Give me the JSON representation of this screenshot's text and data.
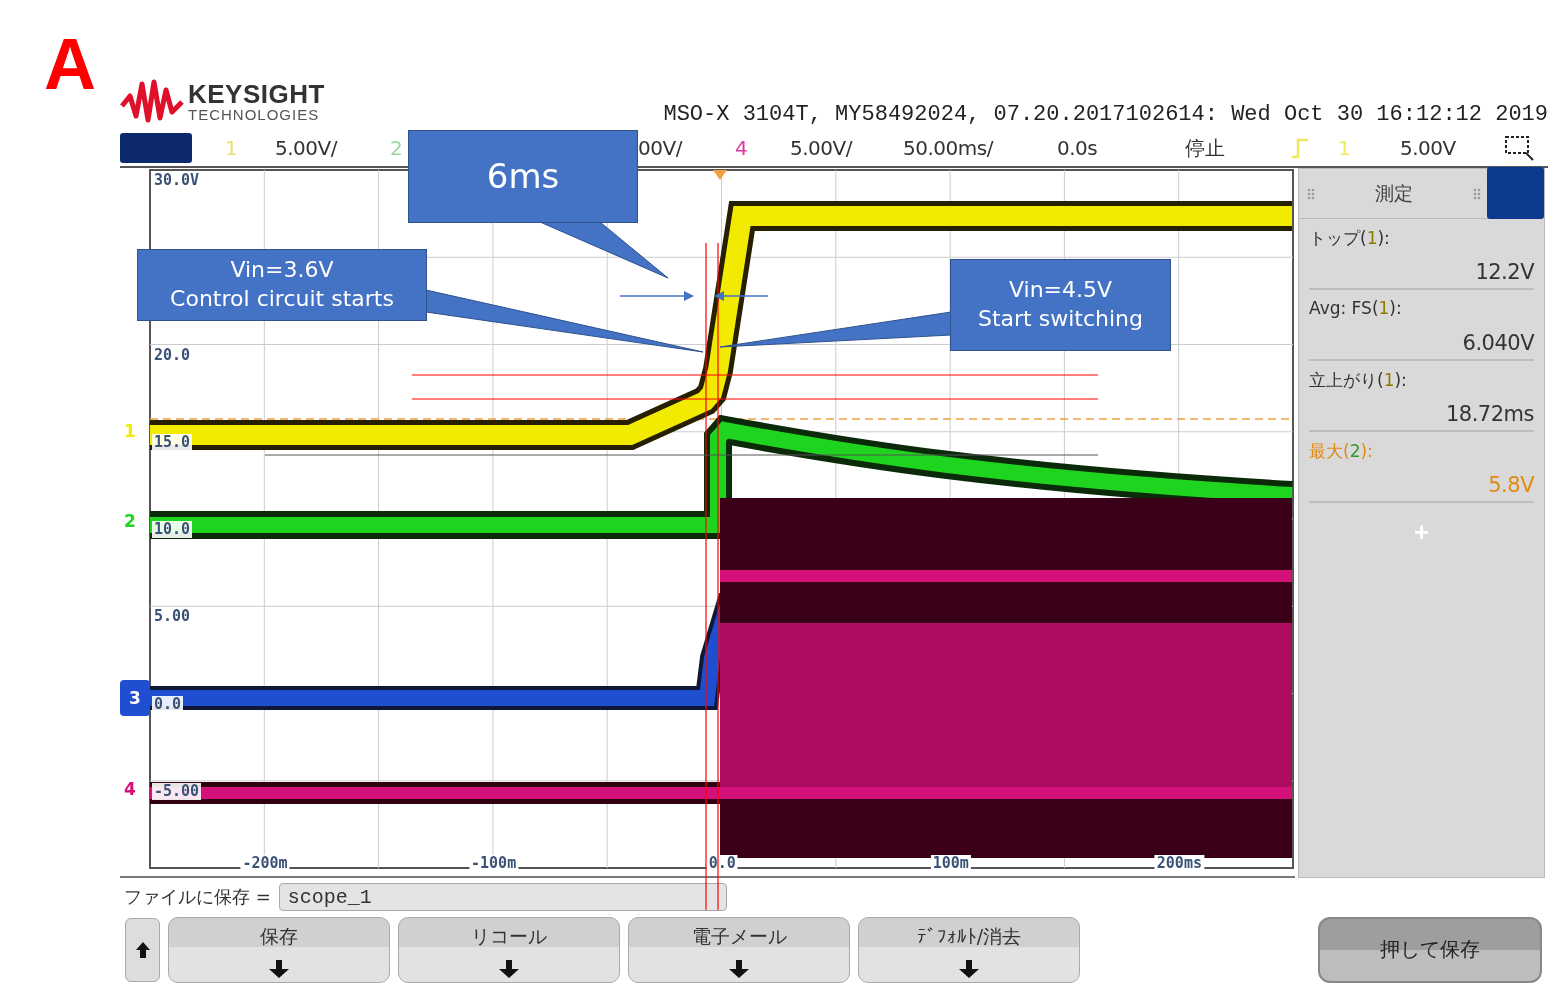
{
  "figure_label": "A",
  "scope": {
    "logo": {
      "name": "KEYSIGHT",
      "subtitle": "TECHNOLOGIES"
    },
    "title": "MSO-X 3104T, MY58492024, 07.20.2017102614: Wed Oct 30 16:12:12 2019",
    "status_bar": {
      "channels": [
        {
          "label": "1",
          "value": "5.00V/",
          "color": "#e6e070"
        },
        {
          "label": "2",
          "color": "#9ad89a"
        },
        {
          "value": "00V/"
        },
        {
          "label": "4",
          "value": "5.00V/",
          "color": "#e03aa0"
        }
      ],
      "timebase": "50.00ms/",
      "delay": "0.0s",
      "run_state": "停止",
      "trigger": {
        "source": "1",
        "level": "5.00V",
        "color": "#f0e860"
      }
    },
    "plot": {
      "y_labels": [
        "30.0V",
        "20.0",
        "15.0",
        "10.0",
        "5.00",
        "0.0",
        "-5.00"
      ],
      "x_labels": [
        "-200m",
        "-100m",
        "0.0",
        "100m",
        "200ms"
      ],
      "traces": [
        {
          "marker": "1",
          "color": "#f2ea00"
        },
        {
          "marker": "2",
          "color": "#1fd41f"
        },
        {
          "marker": "3",
          "color": "#1f4fd0"
        },
        {
          "marker": "4",
          "color": "#d4107a"
        }
      ]
    },
    "measurements": {
      "title": "測定",
      "items": [
        {
          "label": "トップ(",
          "channel": "1",
          "label_end": "):",
          "value": "12.2V",
          "kind": "normal"
        },
        {
          "label": "Avg: FS(",
          "channel": "1",
          "label_end": "):",
          "value": "6.040V",
          "kind": "normal"
        },
        {
          "label": "立上がり(",
          "channel": "1",
          "label_end": "):",
          "value": "18.72ms",
          "kind": "normal"
        },
        {
          "label": "最大(",
          "channel": "2",
          "label_end": "):",
          "value": "5.8V",
          "kind": "highlight"
        }
      ],
      "add": "+"
    },
    "file": {
      "label": "ファイルに保存 =",
      "value": "scope_1"
    },
    "softkeys": [
      {
        "label": "保存"
      },
      {
        "label": "リコール"
      },
      {
        "label": "電子メール"
      },
      {
        "label": "ﾃﾞﾌｫﾙﾄ/消去"
      }
    ],
    "save_button": "押して保存"
  },
  "callouts": [
    {
      "text": "6ms"
    },
    {
      "text": "Vin=3.6V\nControl circuit starts"
    },
    {
      "text": "Vin=4.5V\nStart switching"
    }
  ]
}
